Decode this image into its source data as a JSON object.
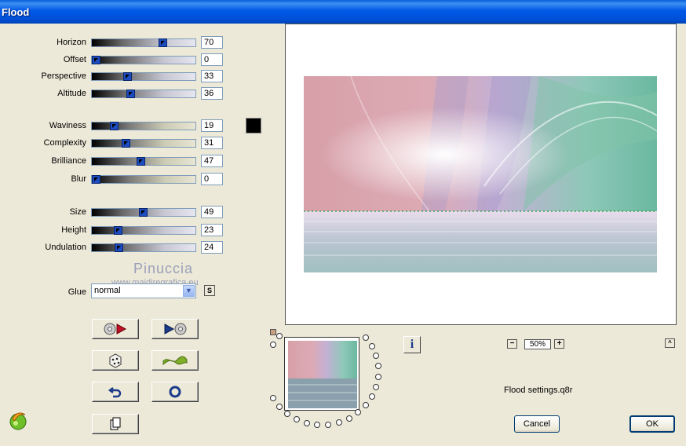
{
  "window": {
    "title": "Flood"
  },
  "sliders_group1": [
    {
      "label": "Horizon",
      "value": "70",
      "pos": 0.7,
      "style": "gray"
    },
    {
      "label": "Offset",
      "value": "0",
      "pos": 0.0,
      "style": "gray"
    },
    {
      "label": "Perspective",
      "value": "33",
      "pos": 0.33,
      "style": "gray"
    },
    {
      "label": "Altitude",
      "value": "36",
      "pos": 0.36,
      "style": "gray"
    }
  ],
  "sliders_group2": [
    {
      "label": "Waviness",
      "value": "19",
      "pos": 0.19,
      "style": "tan"
    },
    {
      "label": "Complexity",
      "value": "31",
      "pos": 0.31,
      "style": "tan"
    },
    {
      "label": "Brilliance",
      "value": "47",
      "pos": 0.47,
      "style": "tan"
    },
    {
      "label": "Blur",
      "value": "0",
      "pos": 0.0,
      "style": "tan"
    }
  ],
  "sliders_group3": [
    {
      "label": "Size",
      "value": "49",
      "pos": 0.49,
      "style": "gray"
    },
    {
      "label": "Height",
      "value": "23",
      "pos": 0.23,
      "style": "gray"
    },
    {
      "label": "Undulation",
      "value": "24",
      "pos": 0.24,
      "style": "gray"
    }
  ],
  "color_swatch": "#000000",
  "watermark": {
    "name": "Pinuccia",
    "site": "www.maidiregrafica.eu"
  },
  "glue": {
    "label": "Glue",
    "value": "normal",
    "s_button": "S"
  },
  "zoom": {
    "value": "50%"
  },
  "status": {
    "text": "Flood settings.q8r"
  },
  "buttons": {
    "cancel": "Cancel",
    "ok": "OK"
  },
  "icons": [
    "play-back-icon",
    "play-forward-icon",
    "dice-icon",
    "wave-icon",
    "undo-icon",
    "reset-icon",
    "copy-icon",
    "info-icon",
    "zoom-minus-icon",
    "zoom-plus-icon",
    "collapse-icon",
    "app-logo-icon"
  ]
}
